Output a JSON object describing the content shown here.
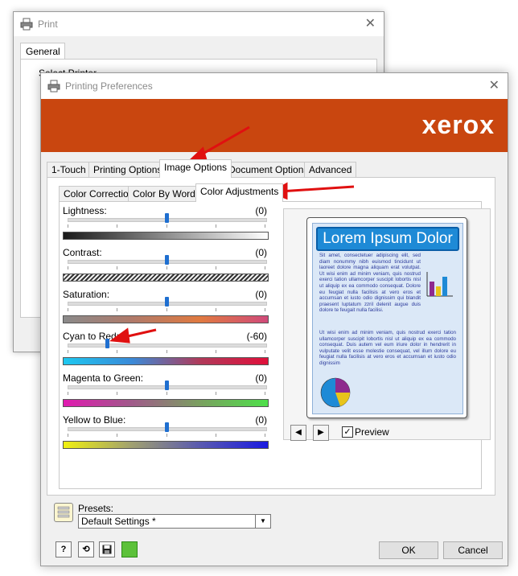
{
  "print_window": {
    "title": "Print",
    "tab": "General",
    "section_label": "Select Printer"
  },
  "prefs_window": {
    "title": "Printing Preferences",
    "brand": "xerox",
    "main_tabs": [
      "1-Touch",
      "Printing Options",
      "Image Options",
      "Document Options",
      "Advanced"
    ],
    "active_main_tab": "Image Options",
    "sub_tabs": [
      "Color Correction",
      "Color By Words",
      "Color Adjustments"
    ],
    "active_sub_tab": "Color Adjustments"
  },
  "sliders": [
    {
      "label": "Lightness:",
      "value": "(0)",
      "level": 0,
      "bar": "lightness"
    },
    {
      "label": "Contrast:",
      "value": "(0)",
      "level": 0,
      "bar": "contrast"
    },
    {
      "label": "Saturation:",
      "value": "(0)",
      "level": 0,
      "bar": "saturation"
    },
    {
      "label": "Cyan to Red:",
      "value": "(-60)",
      "level": -60,
      "bar": "cyan-red"
    },
    {
      "label": "Magenta to Green:",
      "value": "(0)",
      "level": 0,
      "bar": "magenta-green"
    },
    {
      "label": "Yellow to Blue:",
      "value": "(0)",
      "level": 0,
      "bar": "yellow-blue"
    }
  ],
  "preview": {
    "card_title": "Lorem Ipsum Dolor",
    "para1": "Sit amet, consectetuer adipiscing elit, sed diam nonummy nibh euismod tincidunt ut laoreet dolore magna aliquam erat volutpat. Ut wisi enim ad minim veniam, quis nostrud exerci tation ullamcorper suscipit lobortis nisl ut aliquip ex ea commodo consequat. Dolore eu feugiat nulla facilisis at vero eros et accumsan et iusto odio dignissim qui blandit praesent luptatum zzril delenit augue duis dolore te feugait nulla facilisi.",
    "para2": "Ut wisi enim ad minim veniam, quis nostrud exerci tation ullamcorper suscipit lobortis nisl ut aliquip ex ea commodo consequat. Duis autem vel eum iriure dolor in hendrerit in vulputate velit esse molestie consequat, vel illum dolore eu feugiat nulla facilisis at vero eros et accumsan et iusto odio dignissim",
    "checkbox_label": "Preview",
    "checked": true
  },
  "presets": {
    "label": "Presets:",
    "value": "Default Settings *"
  },
  "buttons": {
    "help": "?",
    "ok": "OK",
    "cancel": "Cancel"
  },
  "colors": {
    "brand": "#c9460f",
    "annotation_arrow": "#e01010",
    "slider_thumb": "#1f6fd0"
  }
}
